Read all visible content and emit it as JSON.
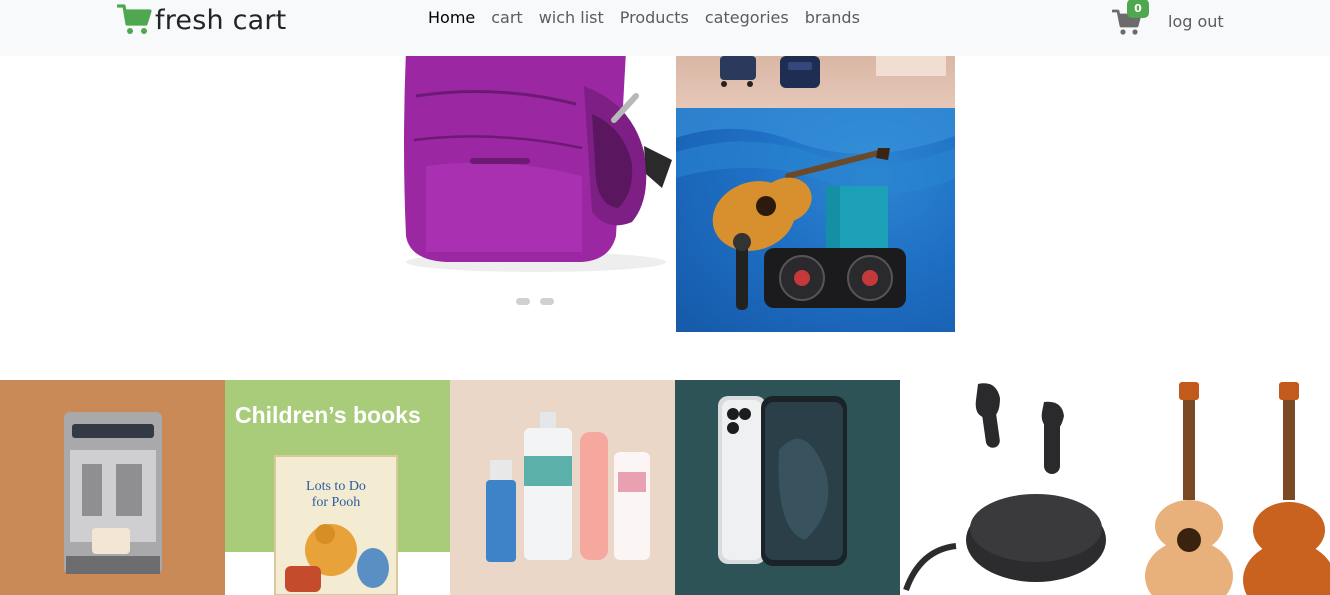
{
  "navbar": {
    "brand_name": "fresh cart",
    "brand_icon": "cart-icon",
    "links": [
      {
        "label": "Home",
        "active": true
      },
      {
        "label": "cart",
        "active": false
      },
      {
        "label": "wich list",
        "active": false
      },
      {
        "label": "Products",
        "active": false
      },
      {
        "label": "categories",
        "active": false
      },
      {
        "label": "brands",
        "active": false
      }
    ],
    "cart_count": "0",
    "logout_label": "log out"
  },
  "slider": {
    "slide_count": 2
  },
  "categories": [
    {
      "name": "coffee-machine"
    },
    {
      "name": "childrens-books",
      "title": "Children’s books"
    },
    {
      "name": "skincare"
    },
    {
      "name": "smartphone"
    },
    {
      "name": "earbuds"
    },
    {
      "name": "guitar"
    }
  ],
  "colors": {
    "brand_green": "#4fa74f",
    "navbar_bg": "#f8f9fa"
  }
}
